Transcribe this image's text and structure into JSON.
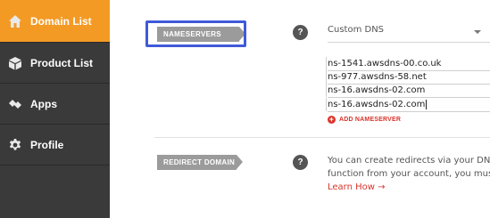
{
  "sidebar": {
    "items": [
      {
        "label": "Domain List",
        "icon": "home-icon",
        "active": true
      },
      {
        "label": "Product List",
        "icon": "box-icon",
        "active": false
      },
      {
        "label": "Apps",
        "icon": "apps-icon",
        "active": false
      },
      {
        "label": "Profile",
        "icon": "gear-icon",
        "active": false
      }
    ]
  },
  "nameservers": {
    "label": "NAMESERVERS",
    "help": "?",
    "type_selected": "Custom DNS",
    "entries": [
      "ns-1541.awsdns-00.co.uk",
      "ns-977.awsdns-58.net",
      "ns-16.awsdns-02.com",
      "ns-16.awsdns-02.com"
    ],
    "add_label": "ADD NAMESERVER"
  },
  "redirect": {
    "label": "REDIRECT DOMAIN",
    "help": "?",
    "description_line1": "You can create redirects via your DNS pro",
    "description_line2": "function from your account, you must first",
    "link": "Learn How →"
  },
  "colors": {
    "accent": "#f39a25",
    "sidebar": "#3a3a3a",
    "highlight": "#3f5ad8",
    "link": "#d9342b"
  }
}
